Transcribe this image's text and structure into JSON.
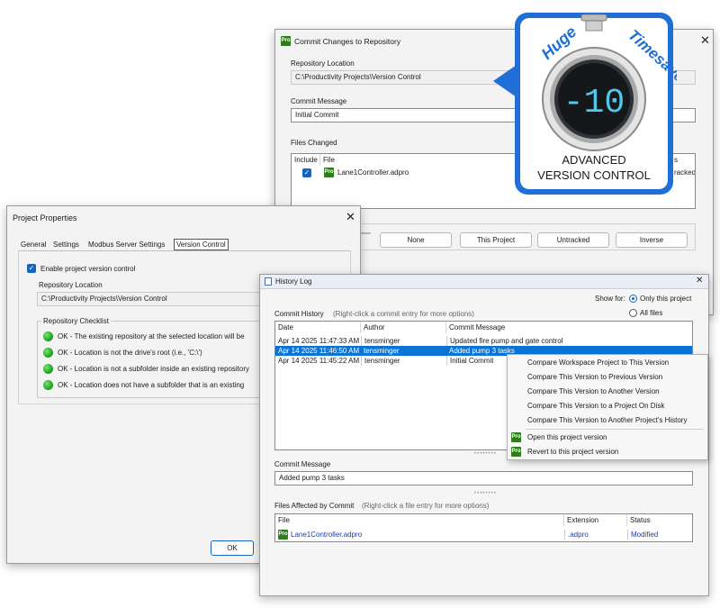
{
  "commit_dialog": {
    "title": "Commit Changes to Repository",
    "app_icon": "pro-icon",
    "repo_location_label": "Repository Location",
    "repo_location_value": "C:\\Productivity Projects\\Version Control",
    "commit_message_label": "Commit Message",
    "commit_message_value": "Initial Commit",
    "files_changed_label": "Files Changed",
    "columns": {
      "include": "Include",
      "file": "File",
      "status_partial": "s"
    },
    "files": [
      {
        "file": "Lane1Controller.adpro",
        "status_partial": "racked"
      }
    ],
    "buttons": {
      "none": "None",
      "this_project": "This Project",
      "untracked": "Untracked",
      "inverse": "Inverse"
    }
  },
  "badge": {
    "huge": "Huge",
    "timesaver": "Timesaver",
    "display": "-10",
    "caption_line1": "ADVANCED",
    "caption_line2": "VERSION CONTROL",
    "icon": "stopwatch-icon"
  },
  "project_props": {
    "title": "Project Properties",
    "tabs": [
      "General",
      "Settings",
      "Modbus Server Settings",
      "Version Control"
    ],
    "enable_label": "Enable project version control",
    "repo_location_label": "Repository Location",
    "repo_location_value": "C:\\Productivity Projects\\Version Control",
    "checklist_label": "Repository Checklist",
    "checklist": [
      "OK - The existing repository at the selected location will be",
      "OK - Location is not the drive's root (i.e., 'C:\\')",
      "OK - Location is not a subfolder inside an existing repository",
      "OK - Location does not have a subfolder that is an existing"
    ],
    "ok_button": "OK"
  },
  "history_log": {
    "title": "History Log",
    "show_for_label": "Show for:",
    "only_this_project": "Only this project",
    "all_files": "All files",
    "commit_history_label": "Commit History",
    "commit_history_hint": "(Right-click a commit entry for more options)",
    "columns": {
      "date": "Date",
      "author": "Author",
      "message": "Commit Message"
    },
    "commits": [
      {
        "date": "Apr 14 2025 11:47:33 AM",
        "author": "tensminger",
        "message": "Updated fire pump and gate control"
      },
      {
        "date": "Apr 14 2025 11:46:50 AM",
        "author": "tensminger",
        "message": "Added pump 3 tasks"
      },
      {
        "date": "Apr 14 2025 11:45:22 AM",
        "author": "tensminger",
        "message": "Initial Commit"
      }
    ],
    "commit_message_label": "Commit Message",
    "commit_message_value": "Added pump 3 tasks",
    "files_affected_label": "Files Affected by Commit",
    "files_affected_hint": "(Right-click a file entry for more options)",
    "file_columns": {
      "file": "File",
      "extension": "Extension",
      "status": "Status"
    },
    "files": [
      {
        "file": "Lane1Controller.adpro",
        "extension": ".adpro",
        "status": "Modified"
      }
    ]
  },
  "context_menu": {
    "items": [
      "Compare Workspace Project to This Version",
      "Compare This Version to Previous Version",
      "Compare This Version to Another Version",
      "Compare This Version to a Project On Disk",
      "Compare This Version to Another Project's History"
    ],
    "open_item": "Open this project version",
    "revert_item": "Revert to this project version"
  },
  "colors": {
    "accent": "#1565c0",
    "selection": "#0a74d6",
    "badge_blue": "#1f6fd6",
    "status_ok": "#22a622"
  }
}
